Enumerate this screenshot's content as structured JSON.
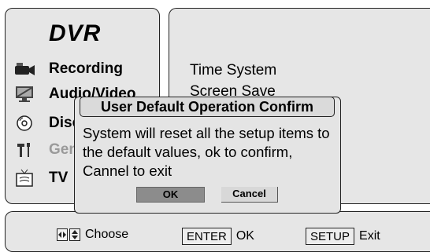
{
  "sidebar": {
    "title": "DVR",
    "items": [
      {
        "label": "Recording",
        "icon": "camcorder-icon",
        "enabled": true
      },
      {
        "label": "Audio/Video",
        "icon": "monitor-icon",
        "enabled": true
      },
      {
        "label": "Disc",
        "icon": "disc-icon",
        "enabled": true
      },
      {
        "label": "General",
        "icon": "tools-icon",
        "enabled": false
      },
      {
        "label": "TV",
        "icon": "tv-icon",
        "enabled": true
      }
    ]
  },
  "settings": {
    "items": [
      "Time System",
      "Screen Save"
    ]
  },
  "dialog": {
    "title": "User Default Operation Confirm",
    "message": "System will reset all the setup items to the default values, ok to confirm, Cannel to exit",
    "ok_label": "OK",
    "cancel_label": "Cancel"
  },
  "footer": {
    "choose_label": "Choose",
    "enter_key": "ENTER",
    "enter_label": "OK",
    "setup_key": "SETUP",
    "setup_label": "Exit"
  }
}
